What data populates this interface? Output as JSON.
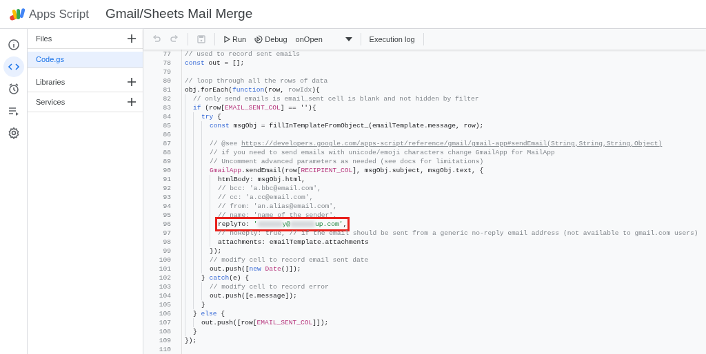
{
  "app": {
    "name": "Apps Script",
    "project_title": "Gmail/Sheets Mail Merge"
  },
  "rail": [
    {
      "kind": "info",
      "selected": false
    },
    {
      "kind": "code",
      "selected": true
    },
    {
      "kind": "triggers",
      "selected": false
    },
    {
      "kind": "executions",
      "selected": false
    },
    {
      "kind": "settings",
      "selected": false
    }
  ],
  "files_panel": {
    "sections": [
      {
        "title": "Files",
        "files": [
          {
            "name": "Code.gs",
            "selected": true
          }
        ]
      },
      {
        "title": "Libraries"
      },
      {
        "title": "Services"
      }
    ]
  },
  "toolbar": {
    "undo_disabled": true,
    "redo_disabled": true,
    "save_disabled": true,
    "run": "Run",
    "debug": "Debug",
    "function": "onOpen",
    "log": "Execution log"
  },
  "code": [
    {
      "number": "77",
      "tokens": [
        {
          "kind": "comment",
          "text": "// used to record sent emails"
        }
      ]
    },
    {
      "number": "78",
      "tokens": [
        {
          "kind": "keyword",
          "text": "const"
        },
        {
          "kind": "plain",
          "text": " out = [];"
        }
      ]
    },
    {
      "number": "79"
    },
    {
      "number": "80",
      "tokens": [
        {
          "kind": "comment",
          "text": "// loop through all the rows of data"
        }
      ]
    },
    {
      "number": "81",
      "tokens": [
        {
          "kind": "plain",
          "text": "obj.forEach("
        },
        {
          "kind": "keyword",
          "text": "function"
        },
        {
          "kind": "plain",
          "text": "(row, "
        },
        {
          "kind": "unused",
          "text": "rowIdx"
        },
        {
          "kind": "plain",
          "text": "){"
        }
      ],
      "children": [
        {
          "number": "82",
          "tokens": [
            {
              "kind": "comment",
              "text": "// only send emails is email_sent cell is blank and not hidden by filter"
            }
          ]
        },
        {
          "number": "83",
          "tokens": [
            {
              "kind": "keyword",
              "text": "if"
            },
            {
              "kind": "plain",
              "text": " (row["
            },
            {
              "kind": "constant",
              "text": "EMAIL_SENT_COL"
            },
            {
              "kind": "plain",
              "text": "] == ''){"
            }
          ],
          "children": [
            {
              "number": "84",
              "tokens": [
                {
                  "kind": "keyword",
                  "text": "try"
                },
                {
                  "kind": "plain",
                  "text": " {"
                }
              ],
              "children": [
                {
                  "number": "85",
                  "tokens": [
                    {
                      "kind": "keyword",
                      "text": "const"
                    },
                    {
                      "kind": "plain",
                      "text": " msgObj = fillInTemplateFromObject_(emailTemplate.message, row);"
                    }
                  ]
                },
                {
                  "number": "86"
                },
                {
                  "number": "87",
                  "tokens": [
                    {
                      "kind": "comment",
                      "text": "// @see "
                    },
                    {
                      "kind": "link",
                      "text": "https://developers.google.com/apps-script/reference/gmail/gmail-app#sendEmail(String,String,String,Object)"
                    }
                  ]
                },
                {
                  "number": "88",
                  "tokens": [
                    {
                      "kind": "comment",
                      "text": "// if you need to send emails with unicode/emoji characters change GmailApp for MailApp"
                    }
                  ]
                },
                {
                  "number": "89",
                  "tokens": [
                    {
                      "kind": "comment",
                      "text": "// Uncomment advanced parameters as needed (see docs for limitations)"
                    }
                  ]
                },
                {
                  "number": "90",
                  "tokens": [
                    {
                      "kind": "constant",
                      "text": "GmailApp"
                    },
                    {
                      "kind": "plain",
                      "text": ".sendEmail(row["
                    },
                    {
                      "kind": "constant",
                      "text": "RECIPIENT_COL"
                    },
                    {
                      "kind": "plain",
                      "text": "], msgObj.subject, msgObj.text, {"
                    }
                  ],
                  "children": [
                    {
                      "number": "91",
                      "tokens": [
                        {
                          "kind": "plain",
                          "text": "htmlBody: msgObj.html,"
                        }
                      ]
                    },
                    {
                      "number": "92",
                      "tokens": [
                        {
                          "kind": "comment",
                          "text": "// bcc: 'a.bbc@email.com',"
                        }
                      ]
                    },
                    {
                      "number": "93",
                      "tokens": [
                        {
                          "kind": "comment",
                          "text": "// cc: 'a.cc@email.com',"
                        }
                      ]
                    },
                    {
                      "number": "94",
                      "tokens": [
                        {
                          "kind": "comment",
                          "text": "// from: 'an.alias@email.com',"
                        }
                      ]
                    },
                    {
                      "number": "95",
                      "tokens": [
                        {
                          "kind": "comment",
                          "text": "// name: 'name of the sender',"
                        }
                      ]
                    },
                    {
                      "number": "96",
                      "highlighted": true,
                      "tokens": [
                        {
                          "kind": "plain",
                          "text": "replyTo: "
                        },
                        {
                          "kind": "string",
                          "text": "'"
                        },
                        {
                          "kind": "redacted"
                        },
                        {
                          "kind": "string",
                          "text": "y@"
                        },
                        {
                          "kind": "redacted"
                        },
                        {
                          "kind": "string",
                          "text": "up.com'"
                        },
                        {
                          "kind": "plain",
                          "text": ","
                        }
                      ]
                    },
                    {
                      "number": "97",
                      "tokens": [
                        {
                          "kind": "comment",
                          "text": "// noReply: true, // if the email should be sent from a generic no-reply email address (not available to gmail.com users)"
                        }
                      ]
                    },
                    {
                      "number": "98",
                      "tokens": [
                        {
                          "kind": "plain",
                          "text": "attachments: emailTemplate.attachments"
                        }
                      ]
                    }
                  ]
                },
                {
                  "number": "99",
                  "tokens": [
                    {
                      "kind": "plain",
                      "text": "});"
                    }
                  ]
                },
                {
                  "number": "100",
                  "tokens": [
                    {
                      "kind": "comment",
                      "text": "// modify cell to record email sent date"
                    }
                  ]
                },
                {
                  "number": "101",
                  "tokens": [
                    {
                      "kind": "plain",
                      "text": "out.push(["
                    },
                    {
                      "kind": "keyword",
                      "text": "new"
                    },
                    {
                      "kind": "constant",
                      "text": " Date"
                    },
                    {
                      "kind": "plain",
                      "text": "()]);"
                    }
                  ]
                }
              ]
            },
            {
              "number": "102",
              "tokens": [
                {
                  "kind": "plain",
                  "text": "} "
                },
                {
                  "kind": "keyword",
                  "text": "catch"
                },
                {
                  "kind": "plain",
                  "text": "(e) {"
                }
              ],
              "children": [
                {
                  "number": "103",
                  "tokens": [
                    {
                      "kind": "comment",
                      "text": "// modify cell to record error"
                    }
                  ]
                },
                {
                  "number": "104",
                  "tokens": [
                    {
                      "kind": "plain",
                      "text": "out.push([e.message]);"
                    }
                  ]
                }
              ]
            },
            {
              "number": "105",
              "tokens": [
                {
                  "kind": "plain",
                  "text": "}"
                }
              ]
            }
          ]
        },
        {
          "number": "106",
          "tokens": [
            {
              "kind": "plain",
              "text": "} "
            },
            {
              "kind": "keyword",
              "text": "else"
            },
            {
              "kind": "plain",
              "text": " {"
            }
          ],
          "children": [
            {
              "number": "107",
              "tokens": [
                {
                  "kind": "plain",
                  "text": "out.push([row["
                },
                {
                  "kind": "constant",
                  "text": "EMAIL_SENT_COL"
                },
                {
                  "kind": "plain",
                  "text": "]]);"
                }
              ]
            }
          ]
        },
        {
          "number": "108",
          "tokens": [
            {
              "kind": "plain",
              "text": "}"
            }
          ]
        }
      ]
    },
    {
      "number": "109",
      "tokens": [
        {
          "kind": "plain",
          "text": "});"
        }
      ]
    },
    {
      "number": "110"
    }
  ]
}
